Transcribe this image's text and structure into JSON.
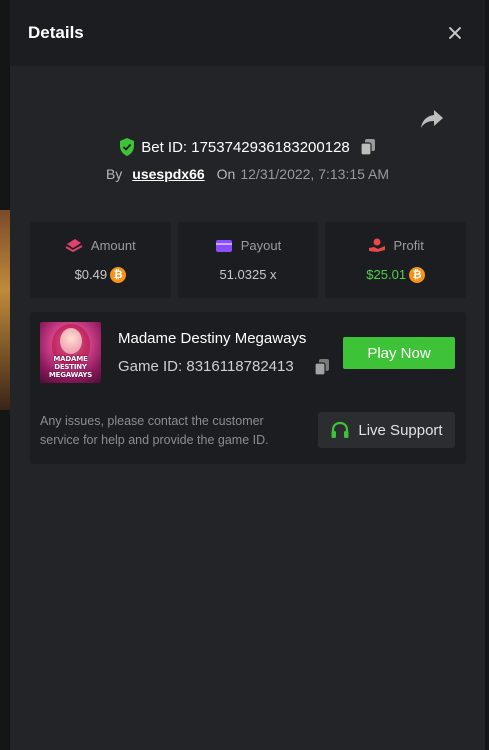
{
  "modal": {
    "title": "Details"
  },
  "bet": {
    "id_label": "Bet ID: 1753742936183200128",
    "by_label": "By",
    "username": "usespdx66",
    "on_label": "On",
    "date": "12/31/2022, 7:13:15 AM"
  },
  "stats": {
    "amount": {
      "label": "Amount",
      "value": "$0.49",
      "icon": "money-stack-icon",
      "color": "#e0406a"
    },
    "payout": {
      "label": "Payout",
      "value": "51.0325 x",
      "icon": "card-icon",
      "color": "#8a4dff"
    },
    "profit": {
      "label": "Profit",
      "value": "$25.01",
      "icon": "hand-coin-icon",
      "color": "#e84a4a",
      "value_color": "#4fd14a"
    }
  },
  "currency": {
    "symbol": "₿",
    "icon": "bitcoin-icon",
    "color": "#f7931a"
  },
  "game": {
    "name": "Madame Destiny Megaways",
    "id_label": "Game ID: 8316118782413",
    "thumbnail_text": "MADAME DESTINY MEGAWAYS",
    "play_label": "Play Now"
  },
  "support": {
    "message": "Any issues, please contact the customer service for help and provide the game ID.",
    "button_label": "Live Support"
  },
  "colors": {
    "accent_green": "#3ec238",
    "modal_bg": "#232427",
    "panel_bg": "#1c1d20"
  }
}
